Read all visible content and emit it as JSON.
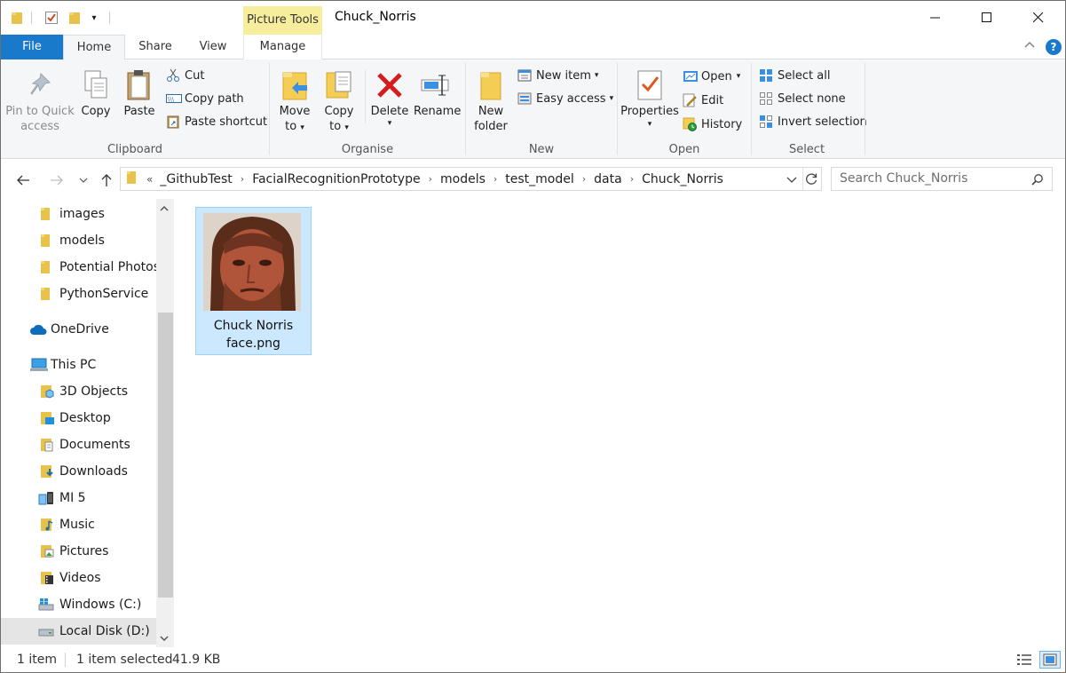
{
  "window": {
    "title": "Chuck_Norris",
    "context_tab_group": "Picture Tools"
  },
  "tabs": [
    {
      "label": "File"
    },
    {
      "label": "Home"
    },
    {
      "label": "Share"
    },
    {
      "label": "View"
    },
    {
      "label": "Manage"
    }
  ],
  "ribbon": {
    "clipboard": {
      "label": "Clipboard",
      "pin_line1": "Pin to Quick",
      "pin_line2": "access",
      "copy": "Copy",
      "paste": "Paste",
      "cut": "Cut",
      "copy_path": "Copy path",
      "paste_shortcut": "Paste shortcut"
    },
    "organise": {
      "label": "Organise",
      "move_line1": "Move",
      "move_line2": "to",
      "copy_line1": "Copy",
      "copy_line2": "to",
      "delete": "Delete",
      "rename": "Rename"
    },
    "new": {
      "label": "New",
      "new_folder_line1": "New",
      "new_folder_line2": "folder",
      "new_item": "New item",
      "easy_access": "Easy access"
    },
    "open": {
      "label": "Open",
      "properties": "Properties",
      "open": "Open",
      "edit": "Edit",
      "history": "History"
    },
    "select": {
      "label": "Select",
      "select_all": "Select all",
      "select_none": "Select none",
      "invert": "Invert selection"
    }
  },
  "address": {
    "overflow": "«",
    "crumbs": [
      "_GithubTest",
      "FacialRecognitionPrototype",
      "models",
      "test_model",
      "data",
      "Chuck_Norris"
    ]
  },
  "search": {
    "placeholder": "Search Chuck_Norris"
  },
  "nav": {
    "items": [
      {
        "label": "images"
      },
      {
        "label": "models"
      },
      {
        "label": "Potential Photos"
      },
      {
        "label": "PythonService"
      },
      {
        "label": "OneDrive"
      },
      {
        "label": "This PC"
      },
      {
        "label": "3D Objects"
      },
      {
        "label": "Desktop"
      },
      {
        "label": "Documents"
      },
      {
        "label": "Downloads"
      },
      {
        "label": "MI 5"
      },
      {
        "label": "Music"
      },
      {
        "label": "Pictures"
      },
      {
        "label": "Videos"
      },
      {
        "label": "Windows (C:)"
      },
      {
        "label": "Local Disk (D:)"
      }
    ]
  },
  "files": [
    {
      "name_line1": "Chuck Norris",
      "name_line2": "face.png"
    }
  ],
  "status": {
    "count": "1 item",
    "selected": "1 item selected",
    "size": "41.9 KB"
  },
  "colors": {
    "accent": "#1979ca",
    "selection": "#cce8ff",
    "context_tab": "#f7ee9d",
    "folder": "#e9c24b"
  }
}
